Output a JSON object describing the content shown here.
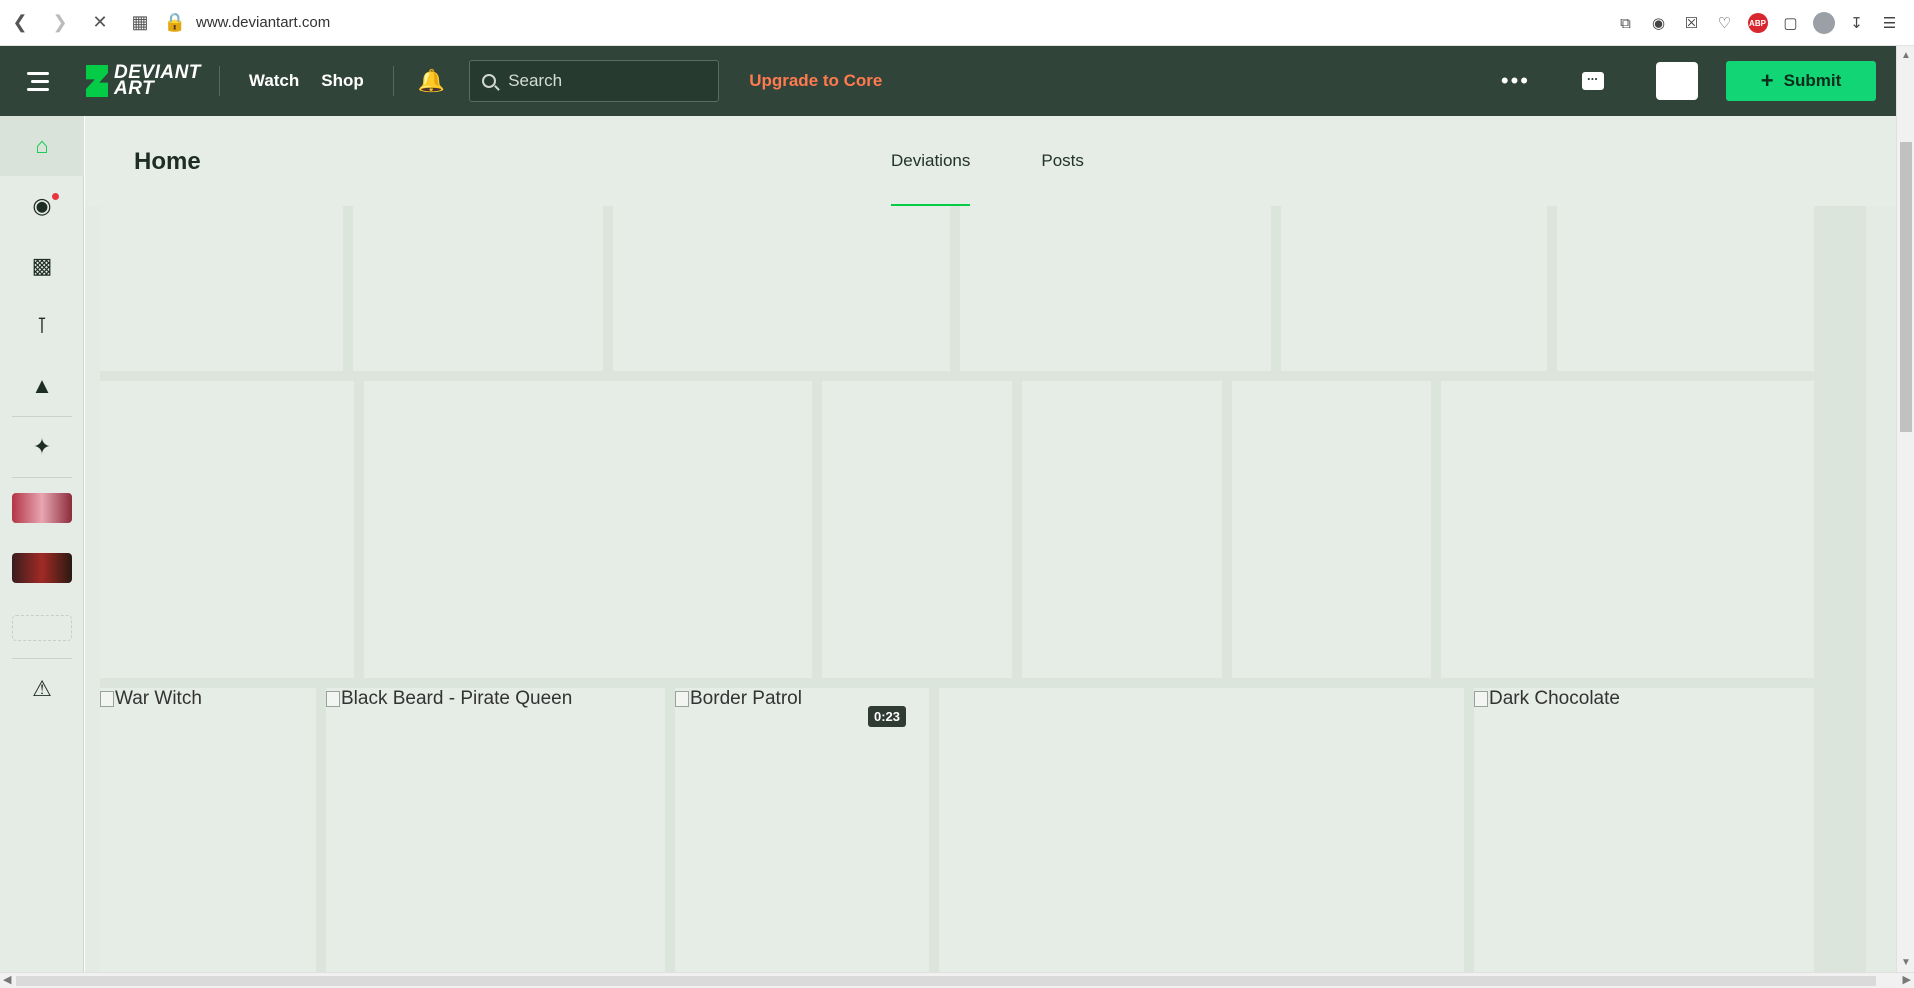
{
  "browser": {
    "url": "www.deviantart.com",
    "abp_label": "ABP"
  },
  "topnav": {
    "logo_line1": "DEVIANT",
    "logo_line2": "ART",
    "watch": "Watch",
    "shop": "Shop",
    "search_placeholder": "Search",
    "upgrade": "Upgrade to Core",
    "more": "•••",
    "submit": "Submit",
    "submit_plus": "+"
  },
  "page": {
    "title": "Home",
    "tabs": [
      {
        "label": "Deviations",
        "active": true
      },
      {
        "label": "Posts",
        "active": false
      }
    ]
  },
  "deviations": [
    {
      "title": "War Witch"
    },
    {
      "title": "Black Beard - Pirate Queen"
    },
    {
      "title": "Border Patrol",
      "duration": "0:23"
    },
    {
      "title": "Dark Chocolate"
    }
  ],
  "colors": {
    "nav_bg": "#31443a",
    "accent": "#05cc47",
    "upgrade": "#ff7a4e",
    "submit_bg": "#12d675"
  }
}
